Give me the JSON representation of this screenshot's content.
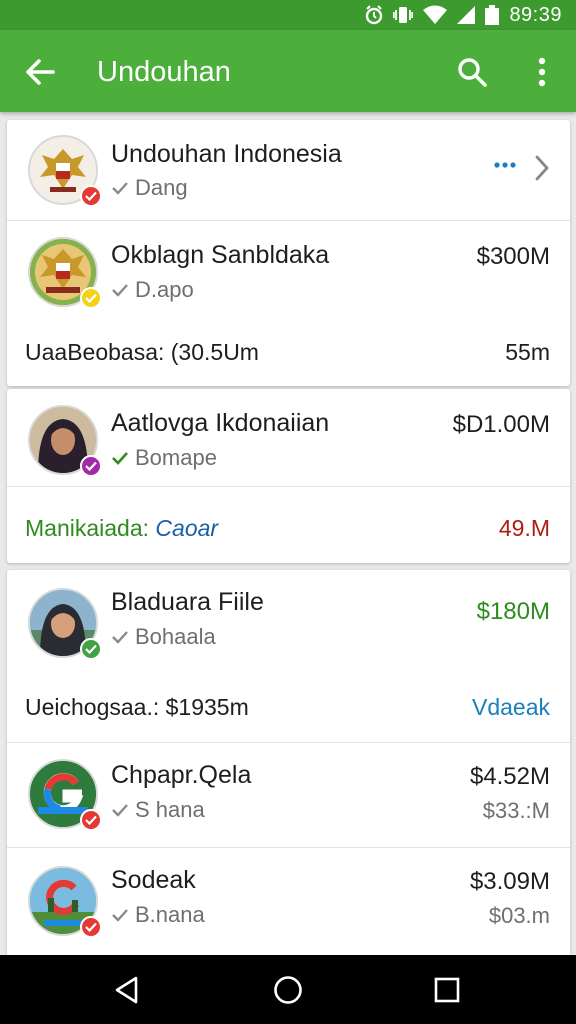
{
  "status_bar": {
    "time": "89:39",
    "icons": [
      "alarm-icon",
      "vibrate-icon",
      "wifi-icon",
      "cell-signal-icon",
      "battery-icon"
    ]
  },
  "app_bar": {
    "title": "Undouhan",
    "icons": [
      "back-arrow-icon",
      "search-icon",
      "overflow-menu-icon"
    ]
  },
  "colors": {
    "app_bar": "#4caf3b",
    "status_bar": "#3d9a2f",
    "green_text": "#2e8b1e",
    "red_text": "#b01e12",
    "blue_text": "#1a7fbf",
    "badge_red": "#e53935",
    "badge_yellow": "#f4d21a",
    "badge_purple": "#a12aa8",
    "badge_green": "#43a047"
  },
  "cards": {
    "header": {
      "name": "Undouhan Indonesia",
      "sub": "Dang",
      "more_icon": "more-dots-icon",
      "chevron_icon": "chevron-right-icon"
    },
    "card1": {
      "name": "Okblagn Sanbldaka",
      "sub": "D.apo",
      "amount": "$300M",
      "footer_label": "UaaBeobasa: (30.5Um",
      "footer_value": "55m"
    },
    "card2": {
      "name": "Aatlovga Ikdonaiian",
      "sub": "Bomape",
      "amount": "$D1.00M",
      "footer_label": "Manikaiada:",
      "footer_label_link": "Caoar",
      "footer_value": "49.M"
    },
    "card3": {
      "name": "Bladuara Fiile",
      "sub": "Bohaala",
      "amount": "$180M",
      "footer_label": "Ueichogsaa.: $1935m",
      "footer_value": "Vdaeak"
    },
    "card4": {
      "name": "Chpapr.Qela",
      "sub": "S hana",
      "amount": "$4.52M",
      "amount2": "$33.:M"
    },
    "card5": {
      "name": "Sodeak",
      "sub": "B.nana",
      "amount": "$3.09M",
      "amount2": "$03.m"
    }
  },
  "nav_bar": {
    "icons": [
      "nav-back-icon",
      "nav-home-icon",
      "nav-recents-icon"
    ]
  }
}
